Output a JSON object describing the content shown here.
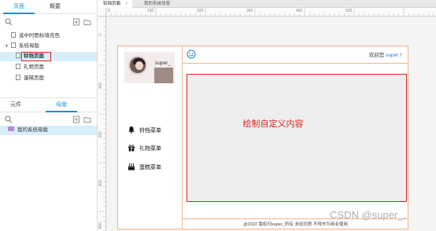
{
  "left_panel": {
    "tabs": [
      "页面",
      "概要"
    ],
    "pages": {
      "items": [
        {
          "label": "选中时图标填充色",
          "level": 1,
          "expanded": false,
          "selected": false
        },
        {
          "label": "系统母版",
          "level": 0,
          "expanded": true,
          "selected": false
        },
        {
          "label": "铃铛页面",
          "level": 1,
          "expanded": false,
          "selected": true
        },
        {
          "label": "礼物页面",
          "level": 1,
          "expanded": false,
          "selected": false
        },
        {
          "label": "蛋糕页面",
          "level": 1,
          "expanded": false,
          "selected": false
        }
      ]
    },
    "lower_tabs": [
      "元件",
      "母版"
    ],
    "masters": [
      {
        "label": "我的系统母版"
      }
    ]
  },
  "workspace": {
    "doc_tabs": [
      {
        "label": "铃铛页面",
        "active": true
      },
      {
        "label": "我的系统母版",
        "active": false
      }
    ],
    "ruler_top": [
      "0",
      "100",
      "200",
      "300",
      "400",
      "500"
    ],
    "ruler_left": [
      "0",
      "100",
      "200",
      "300",
      "400"
    ]
  },
  "design_page": {
    "username": "super_",
    "welcome_prefix": "欢迎您",
    "welcome_user": "super",
    "welcome_suffix": "!",
    "menu": [
      {
        "label": "铃铛菜单",
        "icon": "bell-icon"
      },
      {
        "label": "礼物菜单",
        "icon": "gift-icon"
      },
      {
        "label": "蛋糕菜单",
        "icon": "cake-icon"
      }
    ],
    "content_text": "绘制自定义内容",
    "footer_text": "@2022   版权归super_所有   未经同意 不得作为商业使用"
  },
  "watermark": "CSDN @super_.",
  "colors": {
    "accent": "#1e8fd6",
    "highlight_border": "#e02020",
    "page_border": "#f0b48f",
    "selection_bg": "#d9eefb"
  }
}
